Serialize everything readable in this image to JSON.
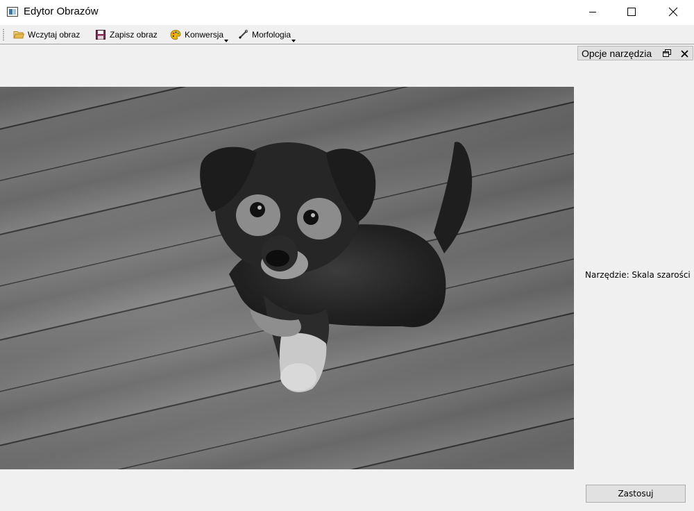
{
  "window": {
    "title": "Edytor Obrazów"
  },
  "toolbar": {
    "load_label": "Wczytaj obraz",
    "save_label": "Zapisz obraz",
    "convert_label": "Konwersja",
    "morphology_label": "Morfologia"
  },
  "dock": {
    "title": "Opcje narzędzia",
    "tool_label": "Narzędzie: Skala szarości",
    "apply_label": "Zastosuj"
  },
  "icons": {
    "app": "app-window-icon",
    "load": "folder-open-icon",
    "save": "floppy-disk-icon",
    "convert": "palette-icon",
    "morphology": "brush-icon",
    "dock_float": "float-window-icon",
    "dock_close": "close-icon"
  },
  "colors": {
    "window_bg": "#f0f0f0",
    "titlebar_bg": "#ffffff",
    "folder": "#e8b84a",
    "palette": "#f2b705",
    "floppy": "#8a2b5a"
  }
}
